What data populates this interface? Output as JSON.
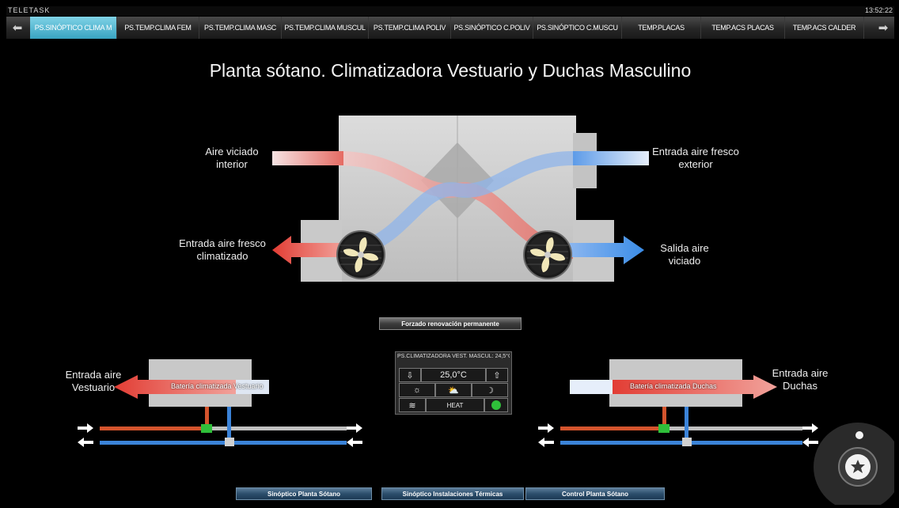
{
  "topbar": {
    "brand": "TELETASK",
    "clock": "13:52:22"
  },
  "tabs": [
    {
      "label": "PS.SINÓPTICO CLIMA M",
      "active": true
    },
    {
      "label": "PS.TEMP.CLIMA FEM",
      "active": false
    },
    {
      "label": "PS.TEMP.CLIMA MASC",
      "active": false
    },
    {
      "label": "PS.TEMP.CLIMA MUSCUL",
      "active": false
    },
    {
      "label": "PS.TEMP.CLIMA POLIV",
      "active": false
    },
    {
      "label": "PS.SINÓPTICO C.POLIV",
      "active": false
    },
    {
      "label": "PS.SINÓPTICO C.MUSCU",
      "active": false
    },
    {
      "label": "TEMP.PLACAS",
      "active": false
    },
    {
      "label": "TEMP.ACS PLACAS",
      "active": false
    },
    {
      "label": "TEMP.ACS CALDER",
      "active": false
    }
  ],
  "title": "Planta sótano. Climatizadora Vestuario y Duchas Masculino",
  "labels": {
    "aire_viciado_interior": "Aire viciado interior",
    "entrada_aire_fresco_exterior": "Entrada aire fresco exterior",
    "entrada_aire_fresco_climatizado": "Entrada aire fresco climatizado",
    "salida_aire_viciado": "Salida aire viciado",
    "entrada_aire_vestuario": "Entrada aire Vestuario",
    "entrada_aire_duchas": "Entrada aire Duchas",
    "bateria_vestuario": "Batería climatizada Vestuario",
    "bateria_duchas": "Batería climatizada Duchas"
  },
  "forzado_button": "Forzado renovación permanente",
  "thermostat": {
    "header": "PS.CLIMATIZADORA VEST. MASCUL: 24,5°C",
    "setpoint": "25,0°C",
    "mode": "HEAT"
  },
  "bottom_nav": [
    "Sinóptico Planta Sótano",
    "Sinóptico Instalaciones Térmicas",
    "Control Planta Sótano"
  ],
  "icons": [
    "arrow-left-icon",
    "arrow-right-icon",
    "fan-icon",
    "star-icon",
    "lightbulb-icon"
  ],
  "colors": {
    "warm": "#e24a3e",
    "cool": "#3f8fe6",
    "accent": "#4fb9d6",
    "power": "#2fbf3a"
  }
}
